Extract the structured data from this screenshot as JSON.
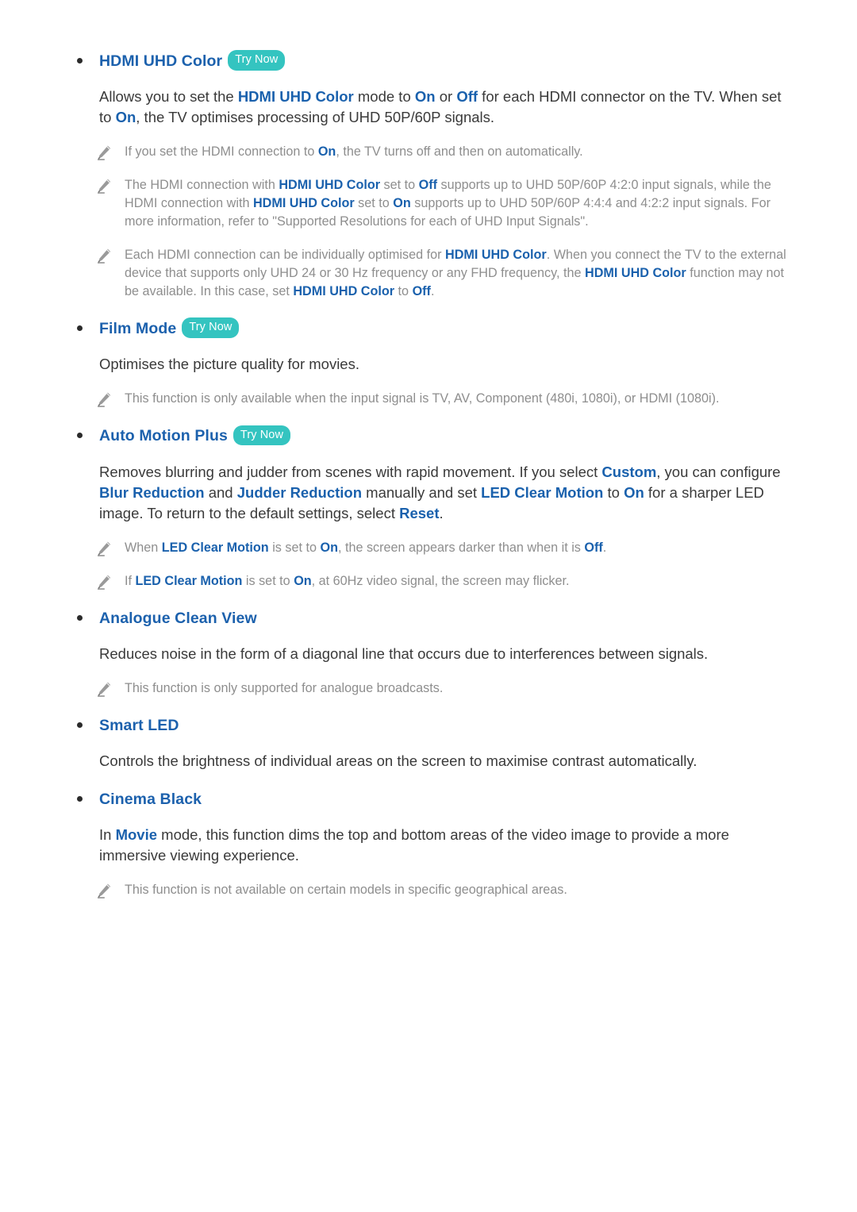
{
  "colors": {
    "heading_blue": "#1c61ad",
    "emphasis_blue": "#1a61ad",
    "body_text": "#3a3a3a",
    "note_text": "#8e8e8e",
    "try_now_badge": "#34c4c0",
    "try_now_text": "#ffffff",
    "bullet": "#2b2b2b",
    "page_background": "#ffffff"
  },
  "icons": {
    "bullet": "bullet-dot-icon",
    "note": "pencil-icon"
  },
  "badges": {
    "try_now": "Try Now"
  },
  "sections": [
    {
      "id": "hdmi-uhd-color",
      "title": "HDMI UHD Color",
      "has_try_now": true,
      "body": [
        {
          "t": "Allows you to set the ",
          "em": false
        },
        {
          "t": "HDMI UHD Color",
          "em": true
        },
        {
          "t": " mode to ",
          "em": false
        },
        {
          "t": "On",
          "em": true
        },
        {
          "t": " or ",
          "em": false
        },
        {
          "t": "Off",
          "em": true
        },
        {
          "t": " for each HDMI connector on the TV. When set to ",
          "em": false
        },
        {
          "t": "On",
          "em": true
        },
        {
          "t": ", the TV optimises processing of UHD 50P/60P signals.",
          "em": false
        }
      ],
      "notes": [
        [
          {
            "t": "If you set the HDMI connection to ",
            "em": false
          },
          {
            "t": "On",
            "em": true
          },
          {
            "t": ", the TV turns off and then on automatically.",
            "em": false
          }
        ],
        [
          {
            "t": "The HDMI connection with ",
            "em": false
          },
          {
            "t": "HDMI UHD Color",
            "em": true
          },
          {
            "t": " set to ",
            "em": false
          },
          {
            "t": "Off",
            "em": true
          },
          {
            "t": " supports up to UHD 50P/60P 4:2:0 input signals, while the HDMI connection with ",
            "em": false
          },
          {
            "t": "HDMI UHD Color",
            "em": true
          },
          {
            "t": " set to ",
            "em": false
          },
          {
            "t": "On",
            "em": true
          },
          {
            "t": " supports up to UHD 50P/60P 4:4:4 and 4:2:2 input signals. For more information, refer to \"Supported Resolutions for each of UHD Input Signals\".",
            "em": false
          }
        ],
        [
          {
            "t": "Each HDMI connection can be individually optimised for ",
            "em": false
          },
          {
            "t": "HDMI UHD Color",
            "em": true
          },
          {
            "t": ". When you connect the TV to the external device that supports only UHD 24 or 30 Hz frequency or any FHD frequency, the ",
            "em": false
          },
          {
            "t": "HDMI UHD Color",
            "em": true
          },
          {
            "t": " function may not be available. In this case, set ",
            "em": false
          },
          {
            "t": "HDMI UHD Color",
            "em": true
          },
          {
            "t": " to ",
            "em": false
          },
          {
            "t": "Off",
            "em": true
          },
          {
            "t": ".",
            "em": false
          }
        ]
      ]
    },
    {
      "id": "film-mode",
      "title": "Film Mode",
      "has_try_now": true,
      "body": [
        {
          "t": "Optimises the picture quality for movies.",
          "em": false
        }
      ],
      "notes": [
        [
          {
            "t": "This function is only available when the input signal is TV, AV, Component (480i, 1080i), or HDMI (1080i).",
            "em": false
          }
        ]
      ]
    },
    {
      "id": "auto-motion-plus",
      "title": "Auto Motion Plus",
      "has_try_now": true,
      "body": [
        {
          "t": "Removes blurring and judder from scenes with rapid movement. If you select ",
          "em": false
        },
        {
          "t": "Custom",
          "em": true
        },
        {
          "t": ", you can configure ",
          "em": false
        },
        {
          "t": "Blur Reduction",
          "em": true
        },
        {
          "t": " and ",
          "em": false
        },
        {
          "t": "Judder Reduction",
          "em": true
        },
        {
          "t": " manually and set ",
          "em": false
        },
        {
          "t": "LED Clear Motion",
          "em": true
        },
        {
          "t": " to ",
          "em": false
        },
        {
          "t": "On",
          "em": true
        },
        {
          "t": " for a sharper LED image. To return to the default settings, select ",
          "em": false
        },
        {
          "t": "Reset",
          "em": true
        },
        {
          "t": ".",
          "em": false
        }
      ],
      "notes": [
        [
          {
            "t": "When ",
            "em": false
          },
          {
            "t": "LED Clear Motion",
            "em": true
          },
          {
            "t": " is set to ",
            "em": false
          },
          {
            "t": "On",
            "em": true
          },
          {
            "t": ", the screen appears darker than when it is ",
            "em": false
          },
          {
            "t": "Off",
            "em": true
          },
          {
            "t": ".",
            "em": false
          }
        ],
        [
          {
            "t": "If ",
            "em": false
          },
          {
            "t": "LED Clear Motion",
            "em": true
          },
          {
            "t": " is set to ",
            "em": false
          },
          {
            "t": "On",
            "em": true
          },
          {
            "t": ", at 60Hz video signal, the screen may flicker.",
            "em": false
          }
        ]
      ]
    },
    {
      "id": "analogue-clean-view",
      "title": "Analogue Clean View",
      "has_try_now": false,
      "body": [
        {
          "t": "Reduces noise in the form of a diagonal line that occurs due to interferences between signals.",
          "em": false
        }
      ],
      "notes": [
        [
          {
            "t": "This function is only supported for analogue broadcasts.",
            "em": false
          }
        ]
      ]
    },
    {
      "id": "smart-led",
      "title": "Smart LED",
      "has_try_now": false,
      "body": [
        {
          "t": "Controls the brightness of individual areas on the screen to maximise contrast automatically.",
          "em": false
        }
      ],
      "notes": []
    },
    {
      "id": "cinema-black",
      "title": "Cinema Black",
      "has_try_now": false,
      "body": [
        {
          "t": "In ",
          "em": false
        },
        {
          "t": "Movie",
          "em": true
        },
        {
          "t": " mode, this function dims the top and bottom areas of the video image to provide a more immersive viewing experience.",
          "em": false
        }
      ],
      "notes": [
        [
          {
            "t": "This function is not available on certain models in specific geographical areas.",
            "em": false
          }
        ]
      ]
    }
  ]
}
